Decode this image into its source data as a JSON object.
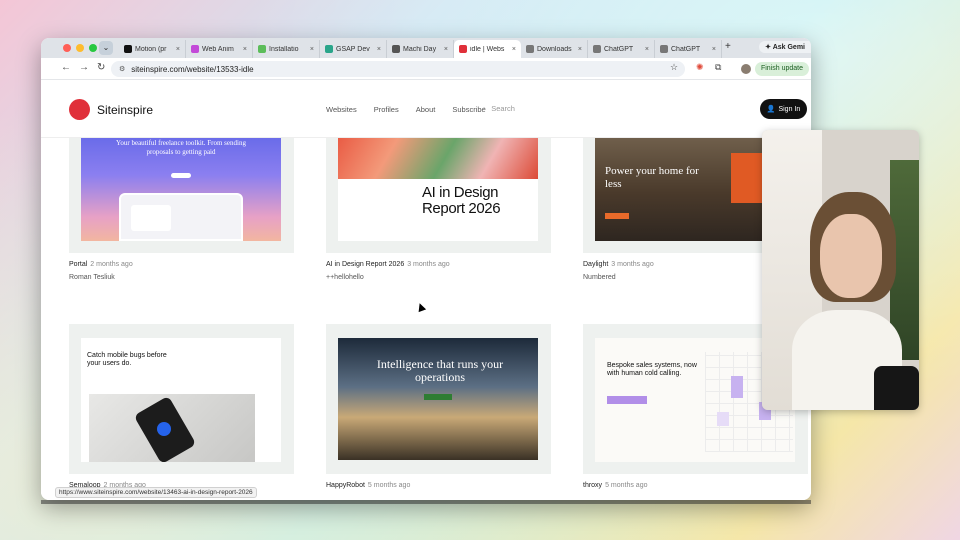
{
  "browser": {
    "tabs": [
      {
        "label": "Motion (pr",
        "color": "#111111"
      },
      {
        "label": "Web Anim",
        "color": "#c34ad8"
      },
      {
        "label": "Installatio",
        "color": "#5cbd5a"
      },
      {
        "label": "GSAP Dev",
        "color": "#2aa58a"
      },
      {
        "label": "Machi Day",
        "color": "#555555"
      },
      {
        "label": "idle | Webs",
        "color": "#e0303a"
      },
      {
        "label": "Downloads",
        "color": "#777777"
      },
      {
        "label": "ChatGPT",
        "color": "#777777"
      },
      {
        "label": "ChatGPT",
        "color": "#777777"
      }
    ],
    "active_tab_index": 5,
    "gemini_label": "Ask Gemi",
    "url": "siteinspire.com/website/13533-idle",
    "finish_update": "Finish update",
    "tab_close_glyph": "×",
    "new_tab_glyph": "+",
    "dropdown_glyph": "⌄"
  },
  "site": {
    "logo_text": "Siteinspire",
    "menu": [
      "Websites",
      "Profiles",
      "About",
      "Subscribe"
    ],
    "search_placeholder": "Search",
    "sign_in": "Sign In",
    "accent": "#e0303a"
  },
  "cards": [
    {
      "title": "Portal",
      "ago": "2 months ago",
      "author": "Roman Tesliuk",
      "shot_text": "Your beautiful freelance toolkit. From sending proposals to getting paid"
    },
    {
      "title": "AI in Design Report 2026",
      "ago": "3 months ago",
      "author": "++hellohello",
      "shot_text": "AI in Design Report 2026"
    },
    {
      "title": "Daylight",
      "ago": "3 months ago",
      "author": "Numbered",
      "shot_text": "Power your home for less"
    },
    {
      "title": "Semaloop",
      "ago": "2 months ago",
      "author": "",
      "shot_text": "Catch mobile bugs before your users do."
    },
    {
      "title": "HappyRobot",
      "ago": "5 months ago",
      "author": "",
      "shot_text": "Intelligence that runs your operations"
    },
    {
      "title": "throxy",
      "ago": "5 months ago",
      "author": "",
      "shot_text": "Bespoke sales systems, now with human cold calling."
    }
  ],
  "status_url": "https://www.siteinspire.com/website/13463-ai-in-design-report-2026"
}
